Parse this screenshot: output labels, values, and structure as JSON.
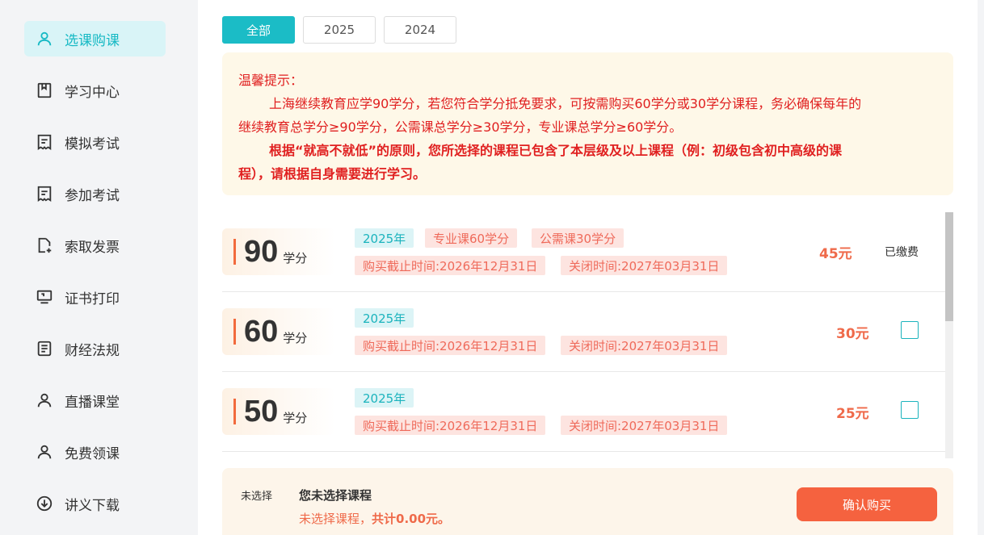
{
  "sidebar": {
    "items": [
      {
        "label": "选课购课",
        "icon": "user-icon",
        "active": true
      },
      {
        "label": "学习中心",
        "icon": "bookmark-book-icon"
      },
      {
        "label": "模拟考试",
        "icon": "exam-doc-icon"
      },
      {
        "label": "参加考试",
        "icon": "exam-doc-icon"
      },
      {
        "label": "索取发票",
        "icon": "invoice-add-icon"
      },
      {
        "label": "证书打印",
        "icon": "monitor-print-icon"
      },
      {
        "label": "财经法规",
        "icon": "document-list-icon"
      },
      {
        "label": "直播课堂",
        "icon": "user-icon"
      },
      {
        "label": "免费领课",
        "icon": "user-icon"
      },
      {
        "label": "讲义下载",
        "icon": "download-circle-icon"
      }
    ]
  },
  "tabs": [
    "全部",
    "2025",
    "2024"
  ],
  "notice": {
    "title": "温馨提示：",
    "line1": "上海继续教育应学90学分，若您符合学分抵免要求，可按需购买60学分或30学分课程，务必确保每年的",
    "line2": "继续教育总学分≥90学分，公需课总学分≥30学分，专业课总学分≥60学分。",
    "line3": "根据“就高不就低”的原则，您所选择的课程已包含了本层级及以上课程（例：初级包含初中高级的课",
    "line4": "程），请根据自身需要进行学习。"
  },
  "credit_unit": "学分",
  "courses": [
    {
      "credits": "90",
      "year": "2025年",
      "tags": [
        "专业课60学分",
        "公需课30学分"
      ],
      "deadline": "购买截止时间:2026年12月31日",
      "close": "关闭时间:2027年03月31日",
      "price": "45元",
      "status": "已缴费"
    },
    {
      "credits": "60",
      "year": "2025年",
      "tags": [],
      "deadline": "购买截止时间:2026年12月31日",
      "close": "关闭时间:2027年03月31日",
      "price": "30元"
    },
    {
      "credits": "50",
      "year": "2025年",
      "tags": [],
      "deadline": "购买截止时间:2026年12月31日",
      "close": "关闭时间:2027年03月31日",
      "price": "25元"
    }
  ],
  "footer": {
    "status": "未选择",
    "title": "您未选择课程",
    "total_prefix": "未选择课程，",
    "total_value": "共计0.00元。",
    "button": "确认购买"
  },
  "colors": {
    "accent": "#1bbcc6",
    "price": "#ef6a4a",
    "notice_text": "#e02020",
    "button": "#f5623f"
  }
}
